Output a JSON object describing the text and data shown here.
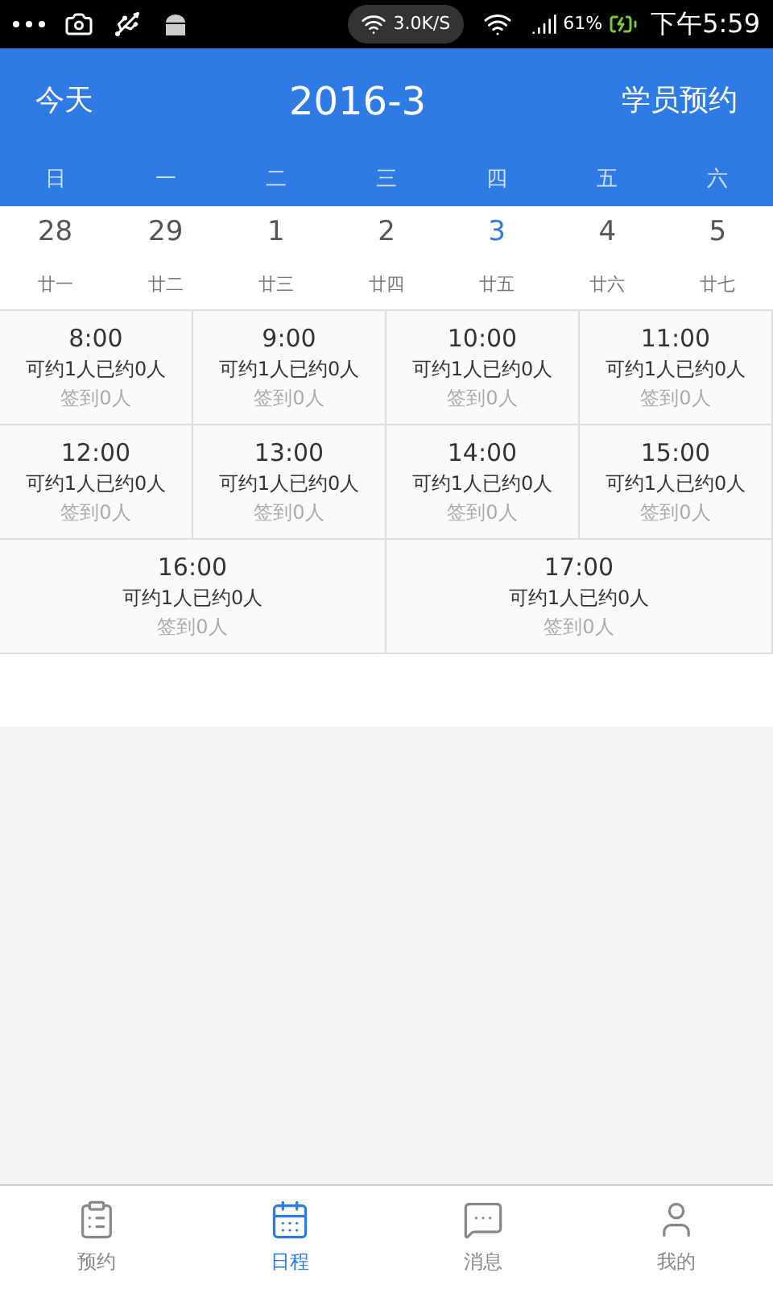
{
  "status_bar": {
    "speed": "3.0K/S",
    "battery": "61%",
    "time": "下午5:59"
  },
  "header": {
    "left": "今天",
    "title": "2016-3",
    "right": "学员预约"
  },
  "days": [
    {
      "weekday": "日",
      "date": "28",
      "lunar": "廿一",
      "selected": false
    },
    {
      "weekday": "一",
      "date": "29",
      "lunar": "廿二",
      "selected": false
    },
    {
      "weekday": "二",
      "date": "1",
      "lunar": "廿三",
      "selected": false
    },
    {
      "weekday": "三",
      "date": "2",
      "lunar": "廿四",
      "selected": false
    },
    {
      "weekday": "四",
      "date": "3",
      "lunar": "廿五",
      "selected": true
    },
    {
      "weekday": "五",
      "date": "4",
      "lunar": "廿六",
      "selected": false
    },
    {
      "weekday": "六",
      "date": "5",
      "lunar": "廿七",
      "selected": false
    }
  ],
  "slot_rows": [
    [
      {
        "time": "8:00",
        "quota": "可约1人已约0人",
        "checkin": "签到0人"
      },
      {
        "time": "9:00",
        "quota": "可约1人已约0人",
        "checkin": "签到0人"
      },
      {
        "time": "10:00",
        "quota": "可约1人已约0人",
        "checkin": "签到0人"
      },
      {
        "time": "11:00",
        "quota": "可约1人已约0人",
        "checkin": "签到0人"
      }
    ],
    [
      {
        "time": "12:00",
        "quota": "可约1人已约0人",
        "checkin": "签到0人"
      },
      {
        "time": "13:00",
        "quota": "可约1人已约0人",
        "checkin": "签到0人"
      },
      {
        "time": "14:00",
        "quota": "可约1人已约0人",
        "checkin": "签到0人"
      },
      {
        "time": "15:00",
        "quota": "可约1人已约0人",
        "checkin": "签到0人"
      }
    ],
    [
      {
        "time": "16:00",
        "quota": "可约1人已约0人",
        "checkin": "签到0人"
      },
      {
        "time": "17:00",
        "quota": "可约1人已约0人",
        "checkin": "签到0人"
      }
    ]
  ],
  "nav": [
    {
      "label": "预约",
      "kind": "list",
      "selected": false
    },
    {
      "label": "日程",
      "kind": "calendar",
      "selected": true
    },
    {
      "label": "消息",
      "kind": "chat",
      "selected": false
    },
    {
      "label": "我的",
      "kind": "user",
      "selected": false
    }
  ]
}
